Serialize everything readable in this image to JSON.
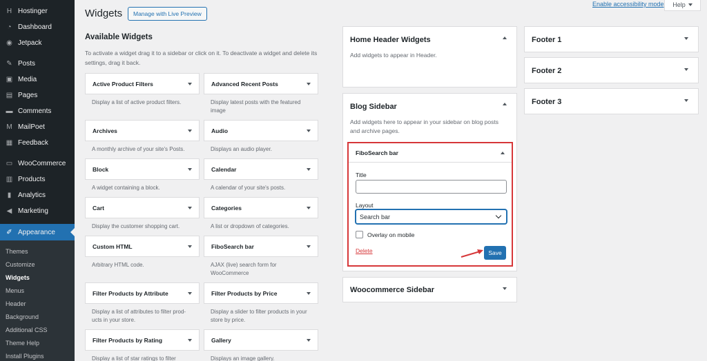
{
  "sidebar": {
    "items": [
      {
        "label": "Hostinger",
        "icon": "hostinger-icon"
      },
      {
        "label": "Dashboard",
        "icon": "dashboard-icon"
      },
      {
        "label": "Jetpack",
        "icon": "jetpack-icon"
      },
      {
        "label": "Posts",
        "icon": "pin-icon"
      },
      {
        "label": "Media",
        "icon": "media-icon"
      },
      {
        "label": "Pages",
        "icon": "pages-icon"
      },
      {
        "label": "Comments",
        "icon": "comments-icon"
      },
      {
        "label": "MailPoet",
        "icon": "mailpoet-icon"
      },
      {
        "label": "Feedback",
        "icon": "feedback-icon"
      },
      {
        "label": "WooCommerce",
        "icon": "woo-icon"
      },
      {
        "label": "Products",
        "icon": "products-icon"
      },
      {
        "label": "Analytics",
        "icon": "analytics-icon"
      },
      {
        "label": "Marketing",
        "icon": "megaphone-icon"
      },
      {
        "label": "Appearance",
        "icon": "brush-icon"
      }
    ],
    "submenu": [
      "Themes",
      "Customize",
      "Widgets",
      "Menus",
      "Header",
      "Background",
      "Additional CSS",
      "Theme Help",
      "Install Plugins"
    ],
    "current_submenu": "Widgets"
  },
  "header": {
    "title": "Widgets",
    "preview_button": "Manage with Live Preview",
    "accessibility_link": "Enable accessibility mode",
    "help_tab": "Help"
  },
  "available": {
    "title": "Available Widgets",
    "description": "To activate a widget drag it to a sidebar or click on it. To deactivate a widget and delete its settings, drag it back.",
    "widgets": [
      {
        "name": "Active Product Filters",
        "desc": "Display a list of active product filters."
      },
      {
        "name": "Advanced Recent Posts",
        "desc": "Display latest posts with the featured image"
      },
      {
        "name": "Archives",
        "desc": "A monthly archive of your site's Posts."
      },
      {
        "name": "Audio",
        "desc": "Displays an audio player."
      },
      {
        "name": "Block",
        "desc": "A widget containing a block."
      },
      {
        "name": "Calendar",
        "desc": "A calendar of your site's posts."
      },
      {
        "name": "Cart",
        "desc": "Display the customer shopping cart."
      },
      {
        "name": "Categories",
        "desc": "A list or dropdown of categories."
      },
      {
        "name": "Custom HTML",
        "desc": "Arbitrary HTML code."
      },
      {
        "name": "FiboSearch bar",
        "desc": "AJAX (live) search form for WooCommerce"
      },
      {
        "name": "Filter Products by Attribute",
        "desc": "Display a list of attributes to filter prod-ucts in your store."
      },
      {
        "name": "Filter Products by Price",
        "desc": "Display a slider to filter products in your store by price."
      },
      {
        "name": "Filter Products by Rating",
        "desc": "Display a list of star ratings to filter"
      },
      {
        "name": "Gallery",
        "desc": "Displays an image gallery."
      }
    ]
  },
  "areas": {
    "home_header": {
      "title": "Home Header Widgets",
      "desc": "Add widgets to appear in Header."
    },
    "blog_sidebar": {
      "title": "Blog Sidebar",
      "desc": "Add widgets here to appear in your sidebar on blog posts and archive pages."
    },
    "woo_sidebar": {
      "title": "Woocommerce Sidebar"
    },
    "footer1": {
      "title": "Footer 1"
    },
    "footer2": {
      "title": "Footer 2"
    },
    "footer3": {
      "title": "Footer 3"
    }
  },
  "fibo_widget": {
    "title": "FiboSearch bar",
    "title_label": "Title",
    "title_value": "",
    "layout_label": "Layout",
    "layout_value": "Search bar",
    "overlay_label": "Overlay on mobile",
    "delete_label": "Delete",
    "save_label": "Save"
  },
  "colors": {
    "accent": "#2271b1",
    "sidebar_bg": "#1d2327",
    "highlight": "#d63638"
  }
}
